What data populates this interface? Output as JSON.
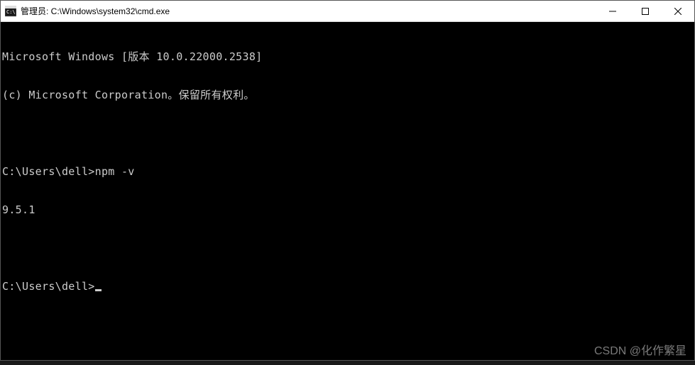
{
  "titlebar": {
    "icon_label": "cmd-icon",
    "title": "管理员: C:\\Windows\\system32\\cmd.exe",
    "minimize_label": "minimize",
    "maximize_label": "maximize",
    "close_label": "close"
  },
  "terminal": {
    "lines": [
      "Microsoft Windows [版本 10.0.22000.2538]",
      "(c) Microsoft Corporation。保留所有权利。",
      "",
      "C:\\Users\\dell>npm -v",
      "9.5.1",
      "",
      "C:\\Users\\dell>"
    ],
    "version_line": "Microsoft Windows [版本 10.0.22000.2538]",
    "copyright_line": "(c) Microsoft Corporation。保留所有权利。",
    "prompt1_path": "C:\\Users\\dell>",
    "command1": "npm -v",
    "output1": "9.5.1",
    "prompt2_path": "C:\\Users\\dell>"
  },
  "watermark": "CSDN @化作繁星"
}
